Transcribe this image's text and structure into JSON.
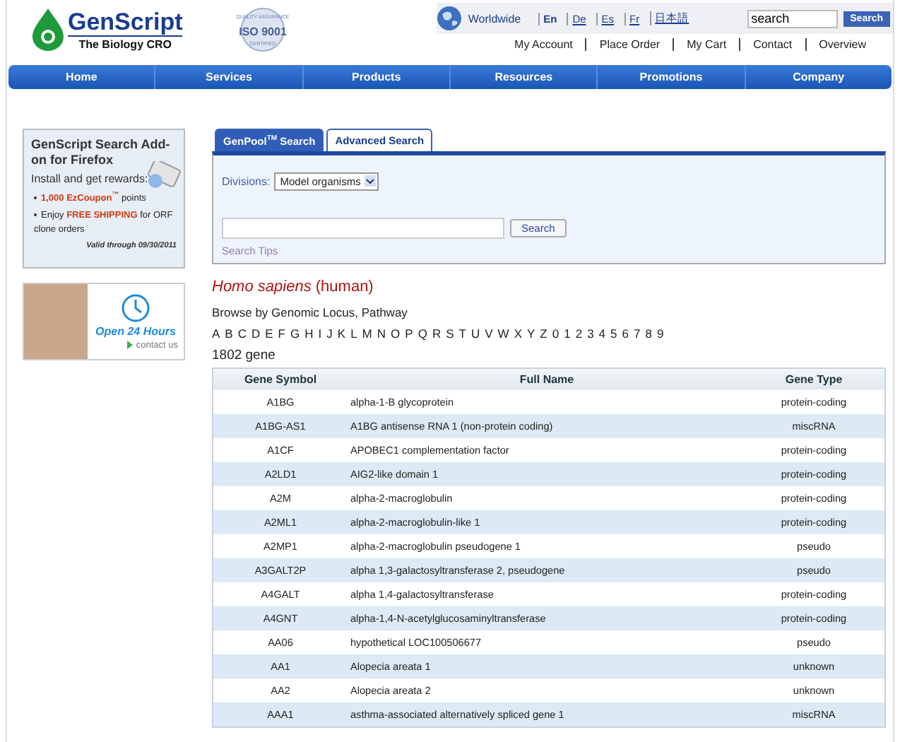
{
  "header": {
    "logo": {
      "name": "GenScript",
      "tagline": "The Biology CRO"
    },
    "badge": {
      "top": "QUALITY ASSURANCE",
      "main": "ISO 9001",
      "bottom": "CERTIFIED"
    },
    "region": "Worldwide",
    "languages": [
      {
        "label": "En",
        "selected": true
      },
      {
        "label": "De",
        "selected": false
      },
      {
        "label": "Es",
        "selected": false
      },
      {
        "label": "Fr",
        "selected": false
      },
      {
        "label": "日本語",
        "selected": false
      }
    ],
    "search": {
      "value": "search",
      "button": "Search"
    },
    "links": [
      "My Account",
      "Place Order",
      "My Cart",
      "Contact",
      "Overview"
    ]
  },
  "nav": [
    "Home",
    "Services",
    "Products",
    "Resources",
    "Promotions",
    "Company"
  ],
  "sidebar": {
    "promo": {
      "title": "GenScript Search Add-on for Firefox",
      "subtitle": "Install and get rewards:",
      "bullets": [
        "**1,000 EzCoupon$^{™}$** points",
        "Enjoy **FREE SHIPPING** for ORF clone orders"
      ],
      "validity": "Valid through 09/30/2011"
    },
    "ad": {
      "headline": "Open 24 Hours",
      "link": "contact us"
    }
  },
  "search_panel": {
    "tabs": [
      {
        "label": "GenPool$^{TM}$ Search",
        "selected": true
      },
      {
        "label": "Advanced Search",
        "selected": false
      }
    ],
    "divisions_label": "Divisions:",
    "divisions_value": "Model organisms",
    "button": "Search",
    "tips": "Search Tips"
  },
  "organism": "*Homo sapiens* (human)",
  "browse": "Browse by Genomic Locus, Pathway",
  "letters": [
    "A",
    "B",
    "C",
    "D",
    "E",
    "F",
    "G",
    "H",
    "I",
    "J",
    "K",
    "L",
    "M",
    "N",
    "O",
    "P",
    "Q",
    "R",
    "S",
    "T",
    "U",
    "V",
    "W",
    "X",
    "Y",
    "Z",
    "0",
    "1",
    "2",
    "3",
    "4",
    "5",
    "6",
    "7",
    "8",
    "9"
  ],
  "count": "1802 gene",
  "table": {
    "columns": [
      "Gene Symbol",
      "Full Name",
      "Gene Type"
    ],
    "rows": [
      [
        "A1BG",
        "alpha-1-B glycoprotein",
        "protein-coding"
      ],
      [
        "A1BG-AS1",
        "A1BG antisense RNA 1 (non-protein coding)",
        "miscRNA"
      ],
      [
        "A1CF",
        "APOBEC1 complementation factor",
        "protein-coding"
      ],
      [
        "A2LD1",
        "AIG2-like domain 1",
        "protein-coding"
      ],
      [
        "A2M",
        "alpha-2-macroglobulin",
        "protein-coding"
      ],
      [
        "A2ML1",
        "alpha-2-macroglobulin-like 1",
        "protein-coding"
      ],
      [
        "A2MP1",
        "alpha-2-macroglobulin pseudogene 1",
        "pseudo"
      ],
      [
        "A3GALT2P",
        "alpha 1,3-galactosyltransferase 2, pseudogene",
        "pseudo"
      ],
      [
        "A4GALT",
        "alpha 1,4-galactosyltransferase",
        "protein-coding"
      ],
      [
        "A4GNT",
        "alpha-1,4-N-acetylglucosaminyltransferase",
        "protein-coding"
      ],
      [
        "AA06",
        "hypothetical LOC100506677",
        "pseudo"
      ],
      [
        "AA1",
        "Alopecia areata 1",
        "unknown"
      ],
      [
        "AA2",
        "Alopecia areata 2",
        "unknown"
      ],
      [
        "AAA1",
        "asthma-associated alternatively spliced gene 1",
        "miscRNA"
      ]
    ]
  }
}
